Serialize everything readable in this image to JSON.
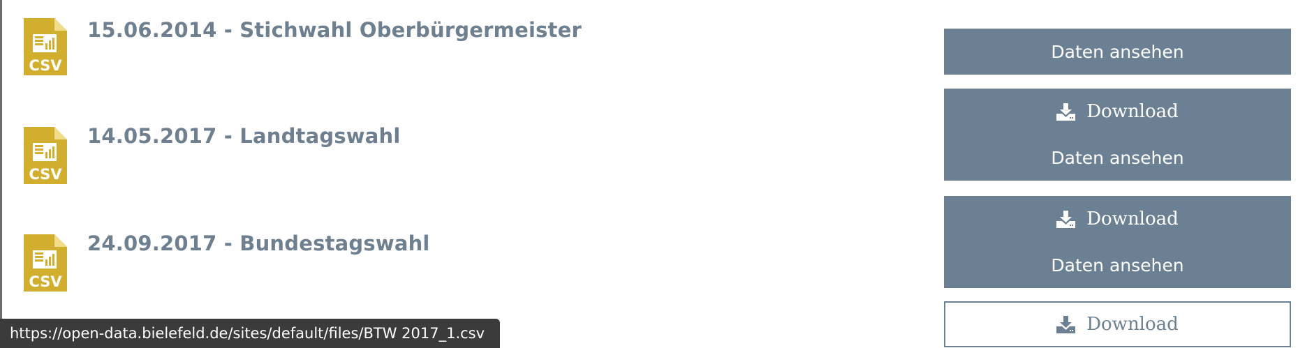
{
  "datasets": [
    {
      "title": "15.06.2014 - Stichwahl Oberbürgermeister",
      "icon_label": "CSV",
      "view_label": "Daten ansehen"
    },
    {
      "title": "14.05.2017 - Landtagswahl",
      "icon_label": "CSV",
      "download_label": "Download",
      "view_label": "Daten ansehen"
    },
    {
      "title": "24.09.2017 - Bundestagswahl",
      "icon_label": "CSV",
      "download_label": "Download",
      "view_label": "Daten ansehen"
    },
    {
      "download_label": "Download"
    }
  ],
  "status_bar": {
    "url": "https://open-data.bielefeld.de/sites/default/files/BTW 2017_1.csv"
  },
  "colors": {
    "button_bg": "#6b8092",
    "title_text": "#6e7f8f",
    "csv_icon": "#d1ae2d",
    "status_bar_bg": "#3b3b3b"
  },
  "icons": {
    "file": "csv-file-icon",
    "download": "download-icon"
  }
}
